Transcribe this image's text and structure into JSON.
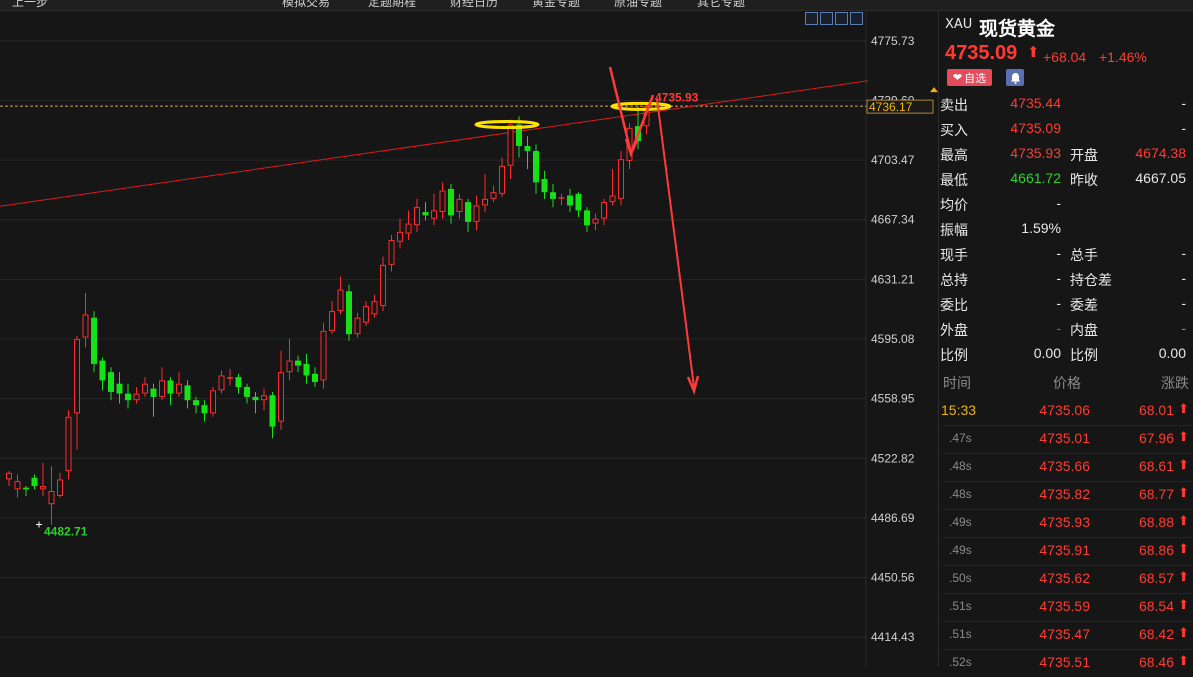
{
  "toolbar": {
    "items": [
      "上一步",
      "模拟交易",
      "定题期程",
      "财经日历",
      "黄金专题",
      "原油专题",
      "其它专题"
    ]
  },
  "chart": {
    "y_axis_labels": [
      "4775.73",
      "4739.60",
      "4703.47",
      "4667.34",
      "4631.21",
      "4595.08",
      "4558.95",
      "4522.82",
      "4486.69",
      "4450.56",
      "4414.43"
    ],
    "current_price_tag": "4736.17",
    "high_label": "4735.93",
    "low_label": "4482.71",
    "colors": {
      "up": "#ff2a2a",
      "down": "#16e016",
      "trendline": "#e01818",
      "annotation": "#ffe000",
      "arrow": "#ff3a3a"
    }
  },
  "chart_data": {
    "type": "candlestick",
    "ylim": [
      4396.37,
      4793.79
    ],
    "y_ticks": [
      4775.73,
      4739.6,
      4703.47,
      4667.34,
      4631.21,
      4595.08,
      4558.95,
      4522.82,
      4486.69,
      4450.56,
      4414.43
    ],
    "last_price": 4736.17,
    "marked_high": 4735.93,
    "marked_low": 4482.71,
    "candles": [
      [
        4510.0,
        4514.0,
        4506.0,
        4515.0
      ],
      [
        4504.0,
        4509.0,
        4499.0,
        4513.0
      ],
      [
        4505.0,
        4504.0,
        4500.0,
        4506.0
      ],
      [
        4511.0,
        4506.0,
        4504.0,
        4513.0
      ],
      [
        4504.0,
        4506.0,
        4500.0,
        4520.0
      ],
      [
        4495.0,
        4503.0,
        4482.71,
        4518.0
      ],
      [
        4500.0,
        4510.0,
        4499.0,
        4514.0
      ],
      [
        4515.0,
        4548.0,
        4510.0,
        4552.0
      ],
      [
        4550.0,
        4595.0,
        4528.0,
        4597.0
      ],
      [
        4596.0,
        4610.0,
        4590.0,
        4623.0
      ],
      [
        4608.0,
        4580.0,
        4575.0,
        4612.0
      ],
      [
        4582.0,
        4570.0,
        4564.0,
        4584.0
      ],
      [
        4575.0,
        4563.0,
        4558.0,
        4578.0
      ],
      [
        4568.0,
        4562.0,
        4556.0,
        4575.0
      ],
      [
        4562.0,
        4558.0,
        4553.0,
        4568.0
      ],
      [
        4558.0,
        4562.0,
        4556.0,
        4566.0
      ],
      [
        4562.0,
        4568.0,
        4560.0,
        4572.0
      ],
      [
        4565.0,
        4560.0,
        4548.0,
        4568.0
      ],
      [
        4560.0,
        4570.0,
        4558.0,
        4578.0
      ],
      [
        4570.0,
        4562.0,
        4555.0,
        4572.0
      ],
      [
        4562.0,
        4568.0,
        4560.0,
        4575.0
      ],
      [
        4567.0,
        4558.0,
        4553.0,
        4570.0
      ],
      [
        4558.0,
        4555.0,
        4550.0,
        4560.0
      ],
      [
        4555.0,
        4550.0,
        4545.0,
        4558.0
      ],
      [
        4550.0,
        4564.0,
        4548.0,
        4566.0
      ],
      [
        4564.0,
        4573.0,
        4562.0,
        4576.0
      ],
      [
        4572.0,
        4572.0,
        4567.0,
        4577.0
      ],
      [
        4572.0,
        4566.0,
        4562.0,
        4574.0
      ],
      [
        4566.0,
        4560.0,
        4556.0,
        4568.0
      ],
      [
        4560.0,
        4558.0,
        4550.0,
        4563.0
      ],
      [
        4558.0,
        4561.0,
        4552.0,
        4565.0
      ],
      [
        4561.0,
        4542.0,
        4535.0,
        4563.0
      ],
      [
        4545.0,
        4575.0,
        4540.0,
        4588.0
      ],
      [
        4575.0,
        4582.0,
        4570.0,
        4595.0
      ],
      [
        4582.0,
        4579.0,
        4575.0,
        4585.0
      ],
      [
        4580.0,
        4573.0,
        4568.0,
        4586.0
      ],
      [
        4574.0,
        4569.0,
        4566.0,
        4578.0
      ],
      [
        4570.0,
        4600.0,
        4565.0,
        4605.0
      ],
      [
        4600.0,
        4612.0,
        4598.0,
        4618.0
      ],
      [
        4612.0,
        4625.0,
        4610.0,
        4633.0
      ],
      [
        4624.0,
        4598.0,
        4594.0,
        4628.0
      ],
      [
        4598.0,
        4608.0,
        4596.0,
        4611.0
      ],
      [
        4605.0,
        4615.0,
        4603.0,
        4618.0
      ],
      [
        4610.0,
        4618.0,
        4608.0,
        4622.0
      ],
      [
        4615.0,
        4640.0,
        4612.0,
        4645.0
      ],
      [
        4640.0,
        4655.0,
        4636.0,
        4658.0
      ],
      [
        4654.0,
        4660.0,
        4650.0,
        4668.0
      ],
      [
        4659.0,
        4665.0,
        4655.0,
        4673.0
      ],
      [
        4664.0,
        4675.0,
        4660.0,
        4680.0
      ],
      [
        4672.0,
        4670.0,
        4667.0,
        4678.0
      ],
      [
        4668.0,
        4673.0,
        4664.0,
        4683.0
      ],
      [
        4672.0,
        4685.0,
        4668.0,
        4690.0
      ],
      [
        4686.0,
        4670.0,
        4665.0,
        4689.0
      ],
      [
        4672.0,
        4680.0,
        4668.0,
        4683.0
      ],
      [
        4678.0,
        4666.0,
        4660.0,
        4680.0
      ],
      [
        4666.0,
        4676.0,
        4661.0,
        4682.0
      ],
      [
        4676.0,
        4680.0,
        4672.0,
        4695.0
      ],
      [
        4680.0,
        4684.0,
        4678.0,
        4688.0
      ],
      [
        4683.0,
        4700.0,
        4681.0,
        4705.0
      ],
      [
        4700.0,
        4725.0,
        4692.0,
        4728.0
      ],
      [
        4725.0,
        4712.0,
        4705.0,
        4730.0
      ],
      [
        4712.0,
        4709.0,
        4698.0,
        4718.0
      ],
      [
        4709.0,
        4690.0,
        4683.0,
        4713.0
      ],
      [
        4692.0,
        4684.0,
        4680.0,
        4697.0
      ],
      [
        4684.0,
        4680.0,
        4675.0,
        4689.0
      ],
      [
        4681.0,
        4681.0,
        4676.0,
        4683.0
      ],
      [
        4682.0,
        4676.0,
        4672.0,
        4686.0
      ],
      [
        4683.0,
        4673.0,
        4669.0,
        4684.0
      ],
      [
        4673.0,
        4664.0,
        4660.0,
        4675.0
      ],
      [
        4665.0,
        4668.0,
        4661.0,
        4671.0
      ],
      [
        4668.0,
        4678.0,
        4664.0,
        4680.0
      ],
      [
        4678.0,
        4682.0,
        4676.0,
        4698.0
      ],
      [
        4680.0,
        4704.0,
        4676.0,
        4709.0
      ],
      [
        4703.0,
        4723.0,
        4698.0,
        4726.0
      ],
      [
        4724.0,
        4715.0,
        4710.0,
        4735.93
      ],
      [
        4724.0,
        4736.0,
        4719.0,
        4736.17
      ]
    ]
  },
  "quote": {
    "code": "XAU",
    "name": "现货黄金",
    "last": "4735.09",
    "change": "+68.04",
    "change_pct": "+1.46%",
    "fav_label": "自选",
    "rows": [
      {
        "l1": "卖出",
        "v1": "4735.44",
        "c1": "red",
        "l2": "",
        "v2": "-",
        "c2": "white"
      },
      {
        "l1": "买入",
        "v1": "4735.09",
        "c1": "red",
        "l2": "",
        "v2": "-",
        "c2": "white"
      },
      {
        "l1": "最高",
        "v1": "4735.93",
        "c1": "red",
        "l2": "开盘",
        "v2": "4674.38",
        "c2": "red"
      },
      {
        "l1": "最低",
        "v1": "4661.72",
        "c1": "green",
        "l2": "昨收",
        "v2": "4667.05",
        "c2": "white"
      },
      {
        "l1": "均价",
        "v1": "-",
        "c1": "white",
        "l2": "",
        "v2": "",
        "c2": "white"
      },
      {
        "l1": "振幅",
        "v1": "1.59%",
        "c1": "white",
        "l2": "",
        "v2": "",
        "c2": "white"
      },
      {
        "l1": "现手",
        "v1": "-",
        "c1": "white",
        "l2": "总手",
        "v2": "-",
        "c2": "white"
      },
      {
        "l1": "总持",
        "v1": "-",
        "c1": "white",
        "l2": "持仓差",
        "v2": "-",
        "c2": "white"
      },
      {
        "l1": "委比",
        "v1": "-",
        "c1": "white",
        "l2": "委差",
        "v2": "-",
        "c2": "white"
      },
      {
        "l1": "外盘",
        "v1": "-",
        "c1": "red",
        "l2": "内盘",
        "v2": "-",
        "c2": "green"
      },
      {
        "l1": "比例",
        "v1": "0.00",
        "c1": "white",
        "l2": "比例",
        "v2": "0.00",
        "c2": "white"
      }
    ]
  },
  "ticks": {
    "headers": [
      "时间",
      "价格",
      "涨跌"
    ],
    "rows": [
      {
        "time": "15:33",
        "price": "4735.06",
        "chg": "68.01"
      },
      {
        "time": ".47s",
        "price": "4735.01",
        "chg": "67.96"
      },
      {
        "time": ".48s",
        "price": "4735.66",
        "chg": "68.61"
      },
      {
        "time": ".48s",
        "price": "4735.82",
        "chg": "68.77"
      },
      {
        "time": ".49s",
        "price": "4735.93",
        "chg": "68.88"
      },
      {
        "time": ".49s",
        "price": "4735.91",
        "chg": "68.86"
      },
      {
        "time": ".50s",
        "price": "4735.62",
        "chg": "68.57"
      },
      {
        "time": ".51s",
        "price": "4735.59",
        "chg": "68.54"
      },
      {
        "time": ".51s",
        "price": "4735.47",
        "chg": "68.42"
      },
      {
        "time": ".52s",
        "price": "4735.51",
        "chg": "68.46"
      }
    ]
  }
}
